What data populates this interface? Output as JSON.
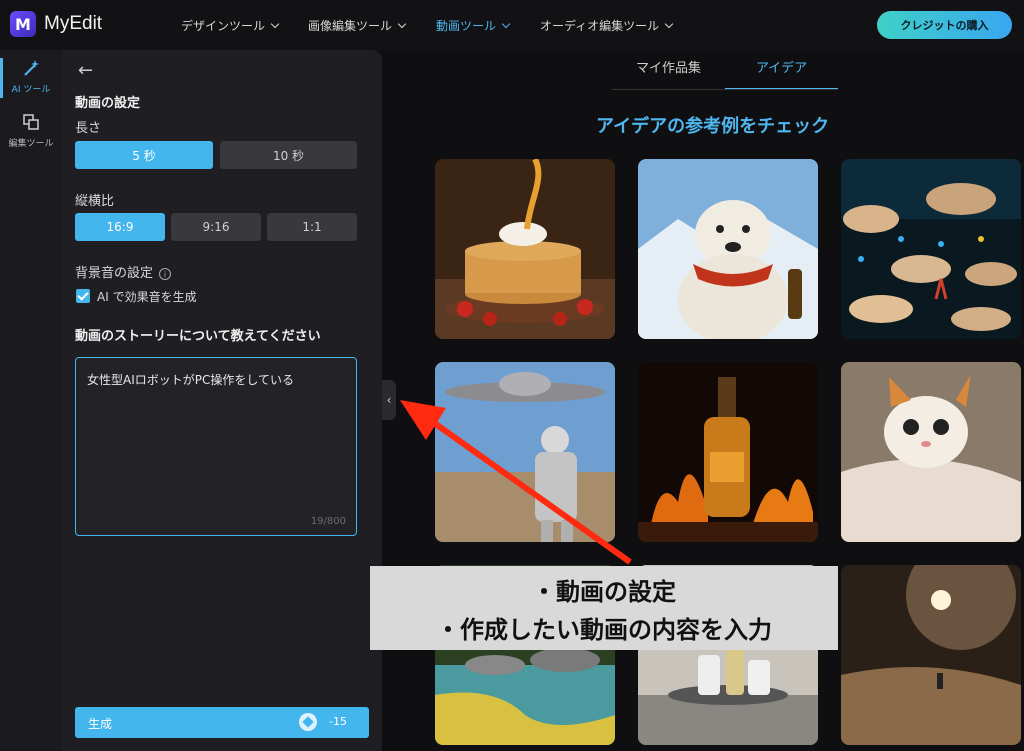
{
  "app": {
    "name": "MyEdit",
    "logo_letter": "M"
  },
  "topnav": {
    "items": [
      {
        "label": "デザインツール",
        "active": false
      },
      {
        "label": "画像編集ツール",
        "active": false
      },
      {
        "label": "動画ツール",
        "active": true
      },
      {
        "label": "オーディオ編集ツール",
        "active": false
      }
    ],
    "credit_button": "クレジットの購入"
  },
  "rail": {
    "items": [
      {
        "label": "AI ツール",
        "icon": "magic-wand-icon",
        "active": true
      },
      {
        "label": "編集ツール",
        "icon": "layers-icon",
        "active": false
      }
    ]
  },
  "panel": {
    "section_title": "動画の設定",
    "length": {
      "label": "長さ",
      "options": [
        "5 秒",
        "10 秒"
      ],
      "selected": "5 秒"
    },
    "aspect": {
      "label": "縦横比",
      "options": [
        "16:9",
        "9:16",
        "1:1"
      ],
      "selected": "16:9"
    },
    "bgm": {
      "label": "背景音の設定",
      "checkbox_label": "AI で効果音を生成",
      "checked": true
    },
    "story": {
      "label": "動画のストーリーについて教えてください",
      "value": "女性型AIロボットがPC操作をしている",
      "count": "19/800"
    },
    "generate": {
      "label": "生成",
      "cost": "-15"
    }
  },
  "content": {
    "tabs": [
      {
        "label": "マイ作品集",
        "active": false
      },
      {
        "label": "アイデア",
        "active": true
      }
    ],
    "heading": "アイデアの参考例をチェック",
    "gallery": [
      "pancakes-with-syrup",
      "polar-bear-with-scarf-and-beer",
      "coral-reef-fish",
      "astronaut-and-ufo",
      "whisky-bottle-in-fire",
      "kitten-in-blanket",
      "crystal-stream-nature",
      "cosmetic-bottles-spa",
      "planet-desert-walker"
    ]
  },
  "annotation": {
    "lines": [
      "・動画の設定",
      "・作成したい動画の内容を入力"
    ],
    "arrow_color": "#ff2a10"
  },
  "colors": {
    "accent": "#44b6ee",
    "background": "#0f0f11",
    "panel": "#1f1f23"
  }
}
